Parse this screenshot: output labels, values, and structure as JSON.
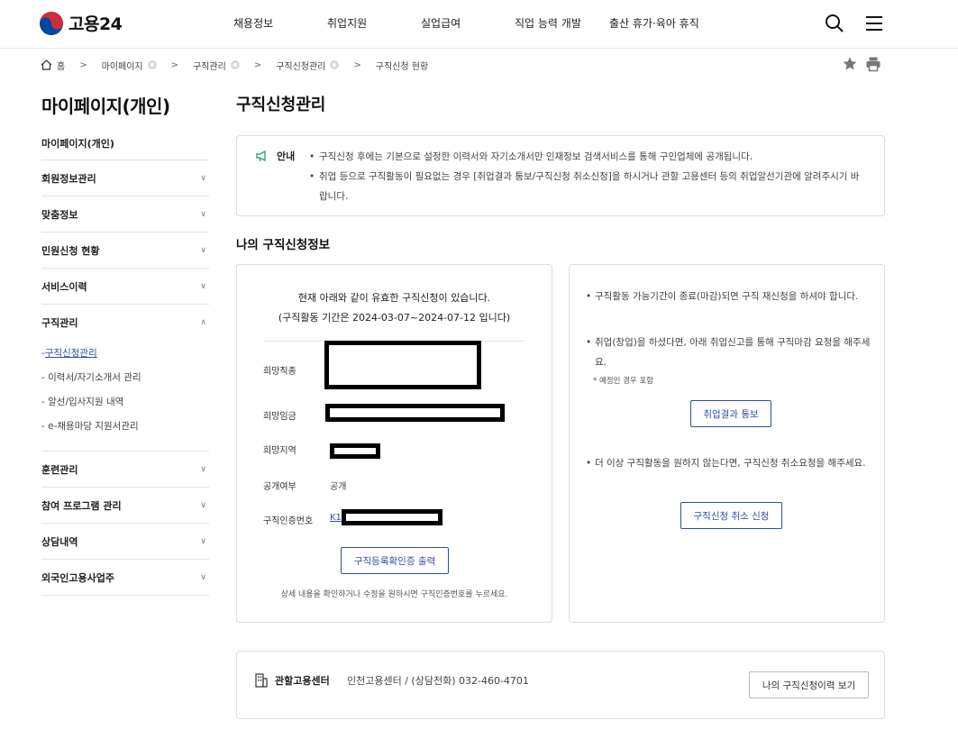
{
  "header": {
    "logo_text": "고용24",
    "nav": [
      "채용정보",
      "취업지원",
      "실업급여",
      "직업 능력 개발",
      "출산 휴가·육아 휴직"
    ],
    "icons": [
      "search-icon",
      "menu-icon"
    ]
  },
  "breadcrumb": {
    "items": [
      "홈",
      "마이페이지",
      "구직관리",
      "구직신청관리",
      "구직신청 현황"
    ],
    "actions": [
      "star-icon",
      "print-icon"
    ]
  },
  "sidebar": {
    "title": "마이페이지(개인)",
    "top_item": "마이페이지(개인)",
    "items": [
      "회원정보관리",
      "맞춤정보",
      "민원신청 현황",
      "서비스이력"
    ],
    "open_group": {
      "label": "구직관리",
      "subitems": [
        "- 구직신청관리",
        "- 이력서/자기소개서 관리",
        "- 알선/입사지원 내역",
        "- e-채용마당 지원서관리"
      ]
    },
    "items_after": [
      "훈련관리",
      "참여 프로그램 관리",
      "상담내역",
      "외국인고용사업주"
    ]
  },
  "main": {
    "title": "구직신청관리",
    "notice": {
      "label": "안내",
      "lines": [
        "구직신청 후에는 기본으로 설정한 이력서와 자기소개서만 인재정보 검색서비스를 통해 구인업체에 공개됩니다.",
        "취업 등으로 구직활동이 필요없는 경우 [취업결과 통보/구직신청 취소신청]을 하시거나 관할 고용센터 등의 취업알선기관에 알려주시기 바랍니다."
      ]
    },
    "section_title": "나의 구직신청정보",
    "left_box": {
      "lead_line1": "현재 아래와 같이 유효한 구직신청이 있습니다.",
      "lead_line2": "(구직활동 기간은 2024-03-07~2024-07-12 입니다)",
      "fields": {
        "job_label": "희망직종",
        "wage_label": "희망임금",
        "region_label": "희망지역",
        "public_label": "공개여부",
        "public_value": "공개",
        "cert_label": "구직인증번호",
        "cert_value_visible": "K1"
      },
      "print_button": "구직등록확인증 출력",
      "footnote": "상세 내용을 확인하거나 수정을 원하시면 구직인증번호를 누르세요."
    },
    "right_box": {
      "text1": "구직활동 가능기간이 종료(마감)되면 구직 재신청을 하셔야 합니다.",
      "text2": "취업(창업)을 하셨다면, 아래 취업신고를 통해 구직마감 요청을 해주세요.",
      "note": "* 예정인 경우 포함",
      "result_button": "취업결과 통보",
      "text3": "더 이상 구직활동을 원하지 않는다면, 구직신청 취소요청을 해주세요.",
      "cancel_button": "구직신청 취소 신청"
    },
    "center": {
      "label": "관할고용센터",
      "value": "인천고용센터 / (상담전화) 032-460-4701",
      "history_button": "나의 구직신청이력 보기"
    }
  }
}
